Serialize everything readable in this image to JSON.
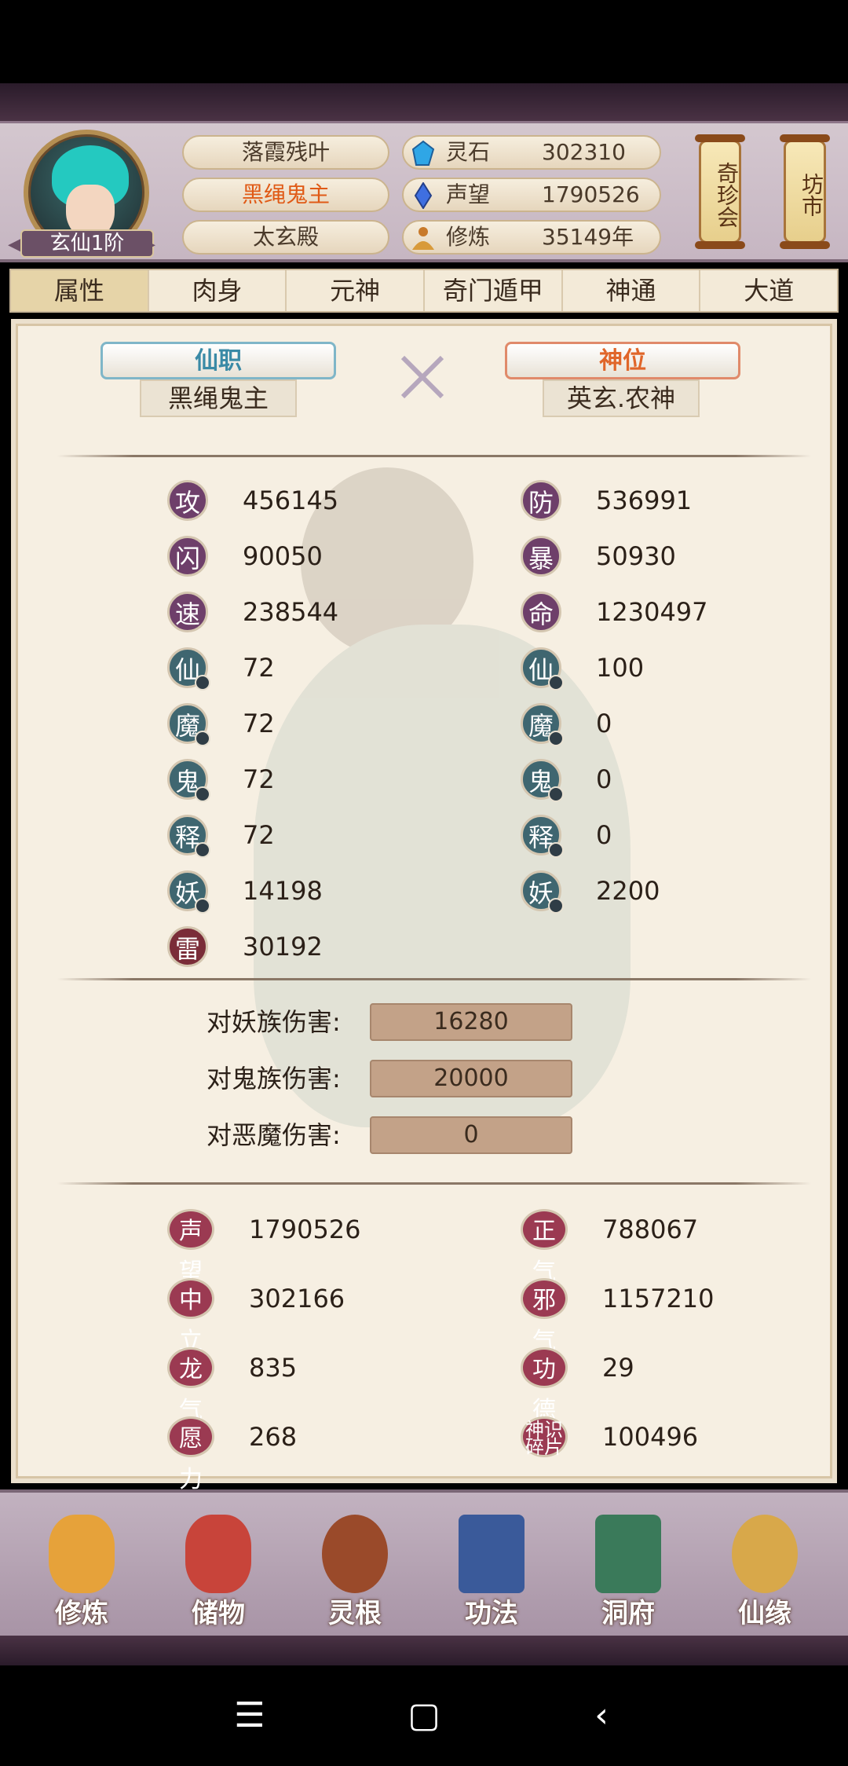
{
  "header": {
    "rank": "玄仙1阶",
    "titles": [
      "落霞残叶",
      "黑绳鬼主",
      "太玄殿"
    ],
    "resources": [
      {
        "icon": "spirit-stone-icon",
        "label": "灵石",
        "value": "302310"
      },
      {
        "icon": "reputation-icon",
        "label": "声望",
        "value": "1790526"
      },
      {
        "icon": "cultivation-icon",
        "label": "修炼",
        "value": "35149年"
      }
    ],
    "lantern_left": "奇珍会",
    "lantern_right": "坊市"
  },
  "tabs": [
    "属性",
    "肉身",
    "元神",
    "奇门遁甲",
    "神通",
    "大道"
  ],
  "posts": {
    "immortal_post": {
      "label": "仙职",
      "value": "黑绳鬼主"
    },
    "god_post": {
      "label": "神位",
      "value": "英玄.农神"
    }
  },
  "stats": {
    "left": [
      {
        "icon": "攻",
        "value": "456145"
      },
      {
        "icon": "闪",
        "value": "90050"
      },
      {
        "icon": "速",
        "value": "238544"
      },
      {
        "icon": "仙",
        "value": "72"
      },
      {
        "icon": "魔",
        "value": "72"
      },
      {
        "icon": "鬼",
        "value": "72"
      },
      {
        "icon": "释",
        "value": "72"
      },
      {
        "icon": "妖",
        "value": "14198"
      },
      {
        "icon": "雷",
        "value": "30192"
      }
    ],
    "right": [
      {
        "icon": "防",
        "value": "536991"
      },
      {
        "icon": "暴",
        "value": "50930"
      },
      {
        "icon": "命",
        "value": "1230497"
      },
      {
        "icon": "仙",
        "value": "100"
      },
      {
        "icon": "魔",
        "value": "0"
      },
      {
        "icon": "鬼",
        "value": "0"
      },
      {
        "icon": "释",
        "value": "0"
      },
      {
        "icon": "妖",
        "value": "2200"
      }
    ]
  },
  "damage": [
    {
      "label": "对妖族伤害:",
      "value": "16280"
    },
    {
      "label": "对鬼族伤害:",
      "value": "20000"
    },
    {
      "label": "对恶魔伤害:",
      "value": "0"
    }
  ],
  "misc": {
    "left": [
      {
        "icon": "声望",
        "value": "1790526"
      },
      {
        "icon": "中立",
        "value": "302166"
      },
      {
        "icon": "龙气",
        "value": "835"
      },
      {
        "icon": "愿力",
        "value": "268"
      }
    ],
    "right": [
      {
        "icon": "正气",
        "value": "788067"
      },
      {
        "icon": "邪气",
        "value": "1157210"
      },
      {
        "icon": "功德",
        "value": "29"
      },
      {
        "icon": "神识碎片",
        "value": "100496"
      }
    ]
  },
  "bottom_nav": [
    "修炼",
    "储物",
    "灵根",
    "功法",
    "洞府",
    "仙缘"
  ],
  "colors": {
    "purple_badge": "#6e3f6a",
    "teal_badge": "#3f6670",
    "red_badge": "#7a2c38",
    "immortal_post": "#3a8aa6",
    "god_post": "#e0662a"
  }
}
